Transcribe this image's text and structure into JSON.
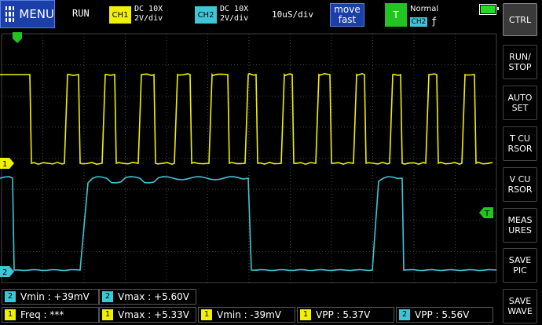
{
  "topbar": {
    "menu_label": "MENU",
    "run_status": "RUN",
    "ch1": {
      "tag": "CH1",
      "coupling": "DC 10X",
      "scale": "2V/div",
      "color": "#f0f000"
    },
    "ch2": {
      "tag": "CH2",
      "coupling": "DC 10X",
      "scale": "2V/div",
      "color": "#3fc6d6"
    },
    "timebase": "10uS/div",
    "move_line1": "move",
    "move_line2": "fast",
    "trigger": {
      "tag": "T",
      "mode": "Normal",
      "source": "CH2",
      "edge": "ƒ",
      "color": "#22c322"
    },
    "battery_level": 1.0
  },
  "sidebar": {
    "buttons": [
      {
        "label": "CTRL",
        "active": true
      },
      {
        "label": "RUN/\nSTOP",
        "active": false
      },
      {
        "label": "AUTO\nSET",
        "active": false
      },
      {
        "label": "T CU\nRSOR",
        "active": false
      },
      {
        "label": "V CU\nRSOR",
        "active": false
      },
      {
        "label": "MEAS\nURES",
        "active": false
      },
      {
        "label": "SAVE\nPIC",
        "active": false
      },
      {
        "label": "SAVE\nWAVE",
        "active": false
      }
    ]
  },
  "markers": {
    "ch1_marker": "1",
    "ch2_marker": "2",
    "trigger_marker": "T"
  },
  "measurements": {
    "row1": [
      {
        "ch": "2",
        "label": "Vmin",
        "value": "+39mV"
      },
      {
        "ch": "2",
        "label": "Vmax",
        "value": "+5.60V"
      }
    ],
    "row2": [
      {
        "ch": "1",
        "label": "Freq",
        "value": "***"
      },
      {
        "ch": "1",
        "label": "Vmax",
        "value": "+5.33V"
      },
      {
        "ch": "1",
        "label": "Vmin",
        "value": "-39mV"
      },
      {
        "ch": "1",
        "label": "VPP",
        "value": "5.37V"
      },
      {
        "ch": "2",
        "label": "VPP",
        "value": "5.56V"
      }
    ]
  },
  "colors": {
    "grid": "#555555",
    "ch1": "#f0f000",
    "ch2": "#3fc6d6",
    "background": "#000000"
  }
}
